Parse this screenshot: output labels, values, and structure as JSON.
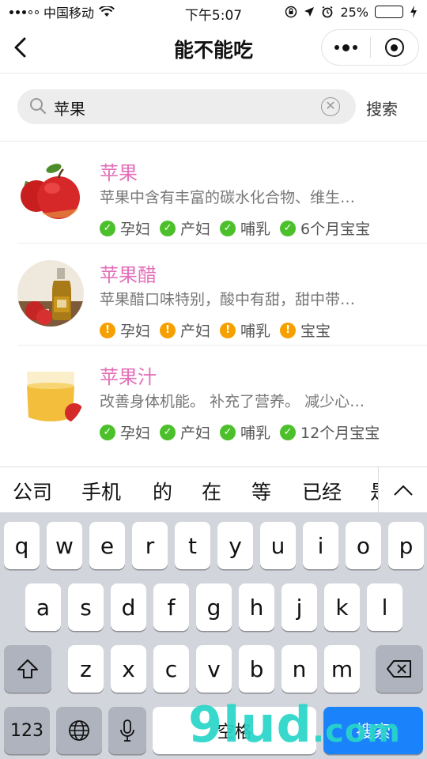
{
  "status_bar": {
    "carrier": "中国移动",
    "time": "下午5:07",
    "battery_percent": "25%",
    "battery_level": 0.25
  },
  "nav": {
    "title": "能不能吃"
  },
  "search": {
    "value": "苹果",
    "button_label": "搜索"
  },
  "results": [
    {
      "name": "苹果",
      "desc": "苹果中含有丰富的碳水化合物、维生…",
      "thumb": "apple",
      "tags": [
        {
          "label": "孕妇",
          "status": "ok"
        },
        {
          "label": "产妇",
          "status": "ok"
        },
        {
          "label": "哺乳",
          "status": "ok"
        },
        {
          "label": "6个月宝宝",
          "status": "ok"
        }
      ]
    },
    {
      "name": "苹果醋",
      "desc": "苹果醋口味特别，酸中有甜，甜中带…",
      "thumb": "vinegar",
      "tags": [
        {
          "label": "孕妇",
          "status": "warn"
        },
        {
          "label": "产妇",
          "status": "warn"
        },
        {
          "label": "哺乳",
          "status": "warn"
        },
        {
          "label": "宝宝",
          "status": "warn"
        }
      ]
    },
    {
      "name": "苹果汁",
      "desc": "改善身体机能。 补充了营养。 减少心…",
      "thumb": "juice",
      "tags": [
        {
          "label": "孕妇",
          "status": "ok"
        },
        {
          "label": "产妇",
          "status": "ok"
        },
        {
          "label": "哺乳",
          "status": "ok"
        },
        {
          "label": "12个月宝宝",
          "status": "ok"
        }
      ]
    }
  ],
  "suggestions": [
    "公司",
    "手机",
    "的",
    "在",
    "等",
    "已经",
    "是"
  ],
  "keyboard": {
    "row1": [
      "q",
      "w",
      "e",
      "r",
      "t",
      "y",
      "u",
      "i",
      "o",
      "p"
    ],
    "row2": [
      "a",
      "s",
      "d",
      "f",
      "g",
      "h",
      "j",
      "k",
      "l"
    ],
    "row3": [
      "z",
      "x",
      "c",
      "v",
      "b",
      "n",
      "m"
    ],
    "num_label": "123",
    "space_label": "空格",
    "search_label": "搜索"
  },
  "watermark": {
    "text": "9lud",
    "suffix": ".com"
  },
  "colors": {
    "accent": "#e36fb8",
    "ok": "#4cc02a",
    "warn": "#f5a000",
    "key_blue": "#1a82fb"
  }
}
